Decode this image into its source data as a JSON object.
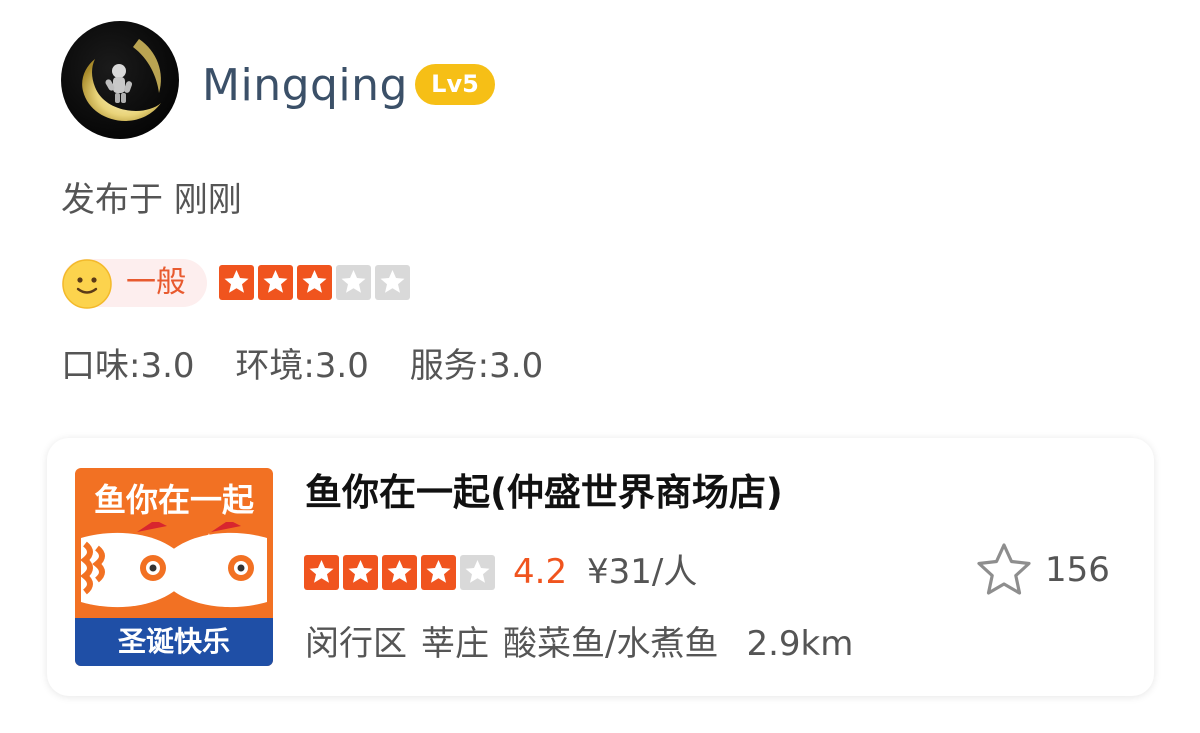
{
  "user": {
    "name": "Mingqing",
    "level": "Lv5"
  },
  "post": {
    "published": "发布于 刚刚"
  },
  "rating": {
    "label": "一般",
    "stars_filled": 3,
    "stars_total": 5,
    "accent_color": "#f0541e"
  },
  "subscores": [
    {
      "text": "口味:3.0"
    },
    {
      "text": "环境:3.0"
    },
    {
      "text": "服务:3.0"
    }
  ],
  "shop": {
    "logo_name": "鱼你在一起",
    "logo_banner": "圣诞快乐",
    "name": "鱼你在一起(仲盛世界商场店)",
    "stars_filled": 4,
    "stars_total": 5,
    "rating": "4.2",
    "price": "¥31/人",
    "district": "闵行区",
    "area": "莘庄",
    "category": "酸菜鱼/水煮鱼",
    "distance": "2.9km",
    "favorites": "156"
  },
  "icons": {
    "avatar": "astronaut-on-moon-avatar",
    "smiley": "smiley-face-icon",
    "star": "star-icon",
    "favorite": "star-outline-icon"
  }
}
